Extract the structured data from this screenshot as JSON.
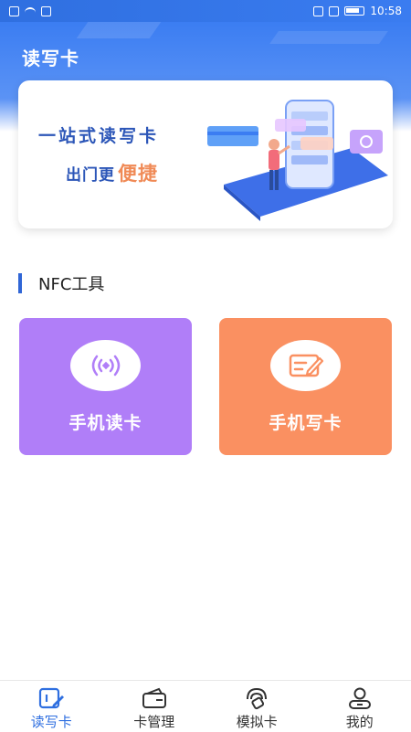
{
  "status_bar": {
    "time": "10:58"
  },
  "header": {
    "title": "读写卡"
  },
  "banner": {
    "line1": "一站式读写卡",
    "line2_prefix": "出门更",
    "line2_highlight": "便捷"
  },
  "section": {
    "title": "NFC工具"
  },
  "tools": [
    {
      "label": "手机读卡",
      "icon": "nfc-signal-icon",
      "color": "#b07ef8"
    },
    {
      "label": "手机写卡",
      "icon": "edit-card-icon",
      "color": "#fa9061"
    }
  ],
  "tabs": [
    {
      "label": "读写卡",
      "icon": "read-write-icon",
      "active": true
    },
    {
      "label": "卡管理",
      "icon": "wallet-icon",
      "active": false
    },
    {
      "label": "模拟卡",
      "icon": "simulate-card-icon",
      "active": false
    },
    {
      "label": "我的",
      "icon": "user-icon",
      "active": false
    }
  ],
  "colors": {
    "primary": "#2f6fe0",
    "accent_orange": "#f08a56"
  }
}
